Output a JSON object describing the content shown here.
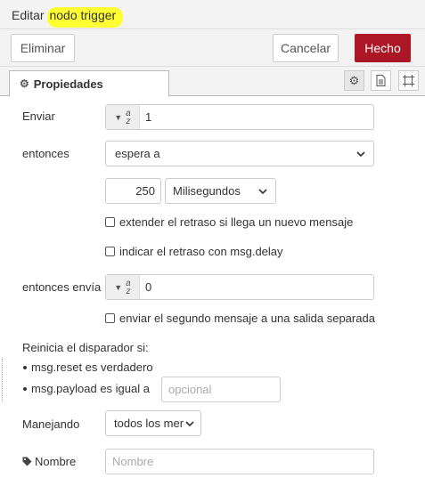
{
  "header": {
    "title_prefix": "Editar",
    "title_node": "nodo trigger"
  },
  "toolbar": {
    "delete_label": "Eliminar",
    "cancel_label": "Cancelar",
    "done_label": "Hecho"
  },
  "tabs": {
    "properties_label": "Propiedades"
  },
  "form": {
    "send_label": "Enviar",
    "send_value": "1",
    "then_label": "entonces",
    "then_option": "espera a",
    "delay_value": "250",
    "delay_unit": "Milisegundos",
    "extend_label": "extender el retraso si llega un nuevo mensaje",
    "override_label": "indicar el retraso con msg.delay",
    "then_send_label": "entonces envía",
    "then_send_value": "0",
    "second_output_label": "enviar el segundo mensaje a una salida separada",
    "reset_label": "Reinicia el disparador si:",
    "reset_rule_1": "msg.reset es verdadero",
    "reset_rule_2": "msg.payload es igual a",
    "reset_placeholder": "opcional",
    "handling_label": "Manejando",
    "handling_option": "todos los men",
    "name_label": "Nombre",
    "name_placeholder": "Nombre"
  },
  "colors": {
    "accent": "#ad1625",
    "highlight": "#ffff33"
  }
}
